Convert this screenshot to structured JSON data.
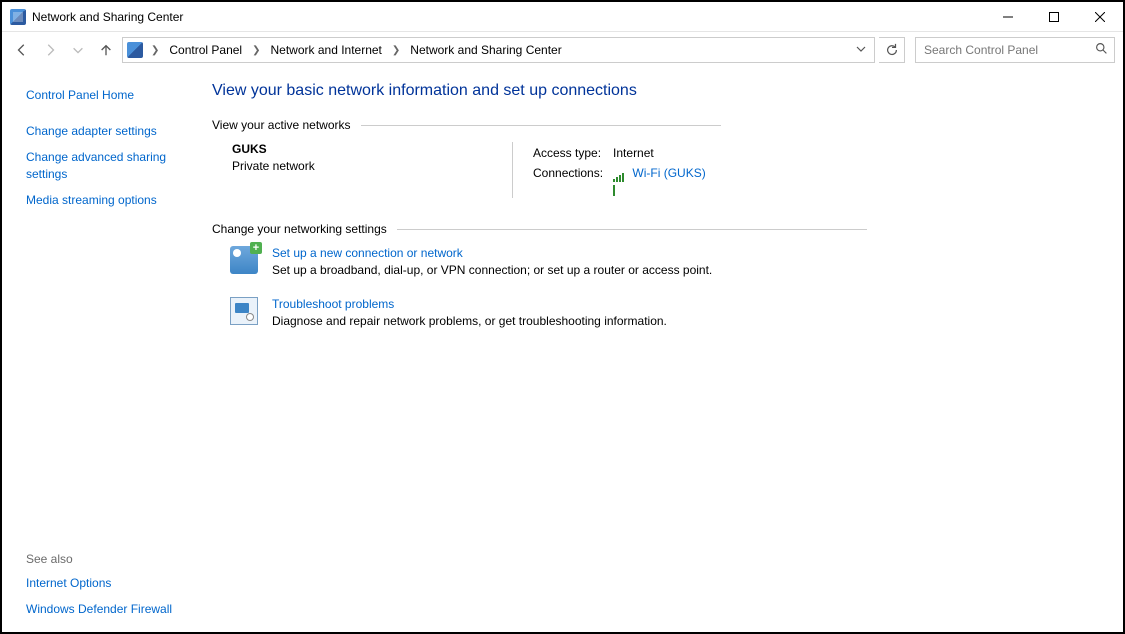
{
  "window": {
    "title": "Network and Sharing Center"
  },
  "breadcrumb": {
    "items": [
      "Control Panel",
      "Network and Internet",
      "Network and Sharing Center"
    ]
  },
  "search": {
    "placeholder": "Search Control Panel"
  },
  "sidebar": {
    "home": "Control Panel Home",
    "links": [
      "Change adapter settings",
      "Change advanced sharing settings",
      "Media streaming options"
    ],
    "seealso_label": "See also",
    "seealso": [
      "Internet Options",
      "Windows Defender Firewall"
    ]
  },
  "main": {
    "heading": "View your basic network information and set up connections",
    "active_label": "View your active networks",
    "network": {
      "name": "GUKS",
      "type": "Private network",
      "access_label": "Access type:",
      "access_value": "Internet",
      "conn_label": "Connections:",
      "conn_link": "Wi-Fi (GUKS)"
    },
    "change_label": "Change your networking settings",
    "items": [
      {
        "title": "Set up a new connection or network",
        "desc": "Set up a broadband, dial-up, or VPN connection; or set up a router or access point."
      },
      {
        "title": "Troubleshoot problems",
        "desc": "Diagnose and repair network problems, or get troubleshooting information."
      }
    ]
  }
}
